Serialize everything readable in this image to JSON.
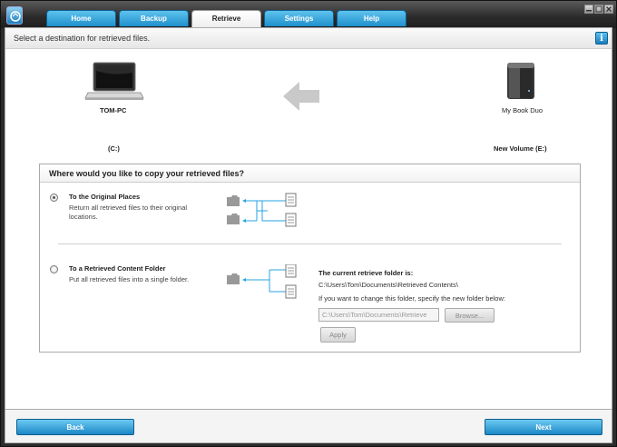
{
  "tabs": [
    {
      "label": "Home"
    },
    {
      "label": "Backup"
    },
    {
      "label": "Retrieve"
    },
    {
      "label": "Settings"
    },
    {
      "label": "Help"
    }
  ],
  "header": {
    "instruction": "Select a destination for retrieved files.",
    "info_icon": "i"
  },
  "source": {
    "name": "TOM-PC",
    "volume": "(C:)",
    "icon": "laptop-icon"
  },
  "destination": {
    "name": "My Book Duo",
    "volume": "New Volume (E:)",
    "icon": "external-drive-icon"
  },
  "panel": {
    "title": "Where would you like to copy your retrieved files?",
    "option1": {
      "title": "To the Original Places",
      "description": "Return all retrieved files to their original locations.",
      "selected": true
    },
    "option2": {
      "title": "To a Retrieved Content Folder",
      "description": "Put all retrieved files into a single folder.",
      "selected": false
    },
    "current_folder_label": "The current retrieve folder is:",
    "current_folder_path": "C:\\Users\\Tom\\Documents\\Retrieved Contents\\",
    "change_hint": "If you want to change this folder, specify the new folder below:",
    "folder_input_value": "C:\\Users\\Tom\\Documents\\Retrieve",
    "browse_label": "Browse...",
    "apply_label": "Apply"
  },
  "footer": {
    "back_label": "Back",
    "next_label": "Next"
  },
  "colors": {
    "accent_blue": "#1f8fcc",
    "arrow_gray": "#c9c9c9",
    "connector_blue": "#29a3e0"
  }
}
